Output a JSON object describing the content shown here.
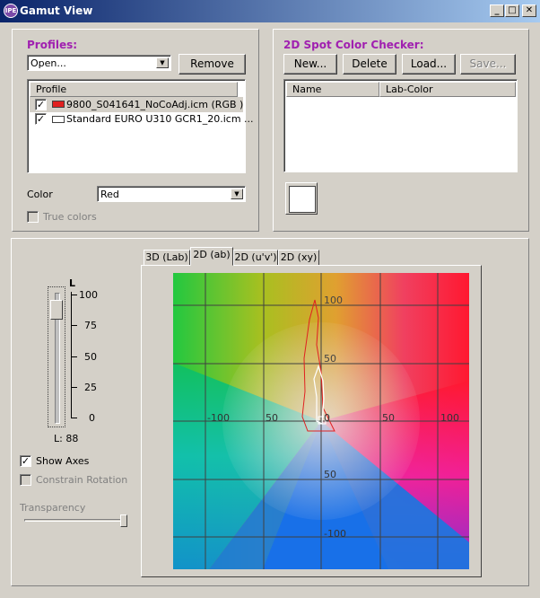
{
  "window": {
    "title": "Gamut View",
    "icon_text": "IPE"
  },
  "profiles": {
    "heading": "Profiles:",
    "open_value": "Open...",
    "remove_label": "Remove",
    "list_header": "Profile",
    "items": [
      {
        "name": "9800_S041641_NoCoAdj.icm (RGB )",
        "checked": true,
        "swatch": "#e02020"
      },
      {
        "name": "Standard EURO U310 GCR1_20.icm ...",
        "checked": true,
        "swatch": "#ffffff"
      }
    ],
    "color_label": "Color",
    "color_value": "Red",
    "true_colors_label": "True colors"
  },
  "spot": {
    "heading": "2D Spot Color Checker:",
    "buttons": [
      "New...",
      "Delete",
      "Load...",
      "Save..."
    ],
    "columns": [
      "Name",
      "Lab-Color"
    ]
  },
  "view": {
    "tabs": [
      "3D (Lab)",
      "2D (ab)",
      "2D (u'v')",
      "2D (xy)"
    ],
    "active_tab": 1,
    "slider_title": "L",
    "slider_ticks": [
      "100",
      "75",
      "50",
      "25",
      "0"
    ],
    "l_readout": "L: 88",
    "show_axes_label": "Show Axes",
    "constrain_label": "Constrain Rotation",
    "transparency_label": "Transparency",
    "axis_labels": {
      "top100": "100",
      "top50": "50",
      "left100": "-100",
      "left50": "50",
      "zero": "0",
      "right50": "50",
      "right100": "100",
      "bottom50": "50",
      "bottom100": "-100"
    }
  }
}
